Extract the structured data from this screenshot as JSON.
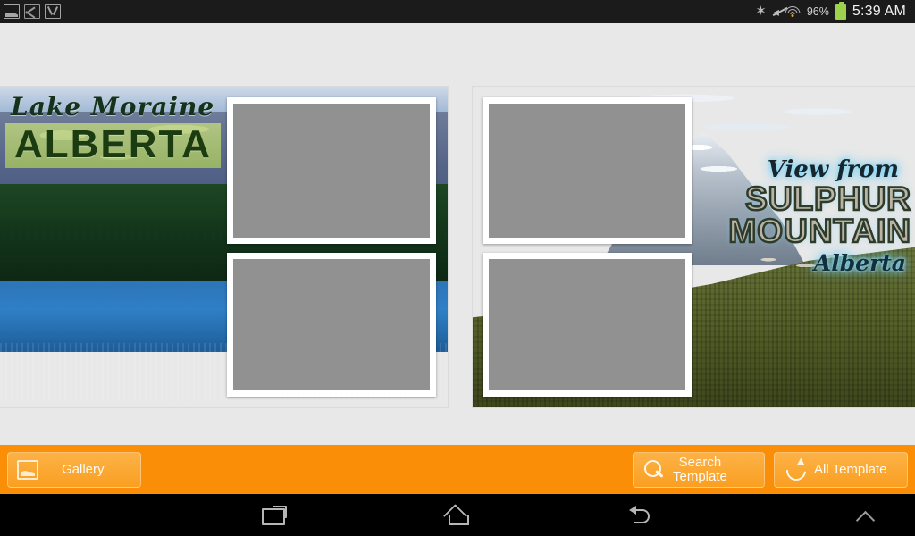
{
  "status_bar": {
    "left_icons": [
      {
        "name": "photo-notification-icon",
        "glyph": "photo"
      },
      {
        "name": "email-notification-icon",
        "glyph": "envelope"
      },
      {
        "name": "gmail-notification-icon",
        "glyph": "gmail"
      }
    ],
    "bluetooth_glyph": "✶",
    "mute_glyph": "◂",
    "battery_percent": "96%",
    "clock": "5:39 AM"
  },
  "templates": [
    {
      "id": "template-left",
      "name": "Lake Moraine Alberta",
      "caption_script": "Lake Moraine",
      "caption_big": "ALBERTA",
      "photo_slots": [
        "slot-l1",
        "slot-l2"
      ]
    },
    {
      "id": "template-right",
      "name": "View from Sulphur Mountain Alberta",
      "caption_script": "View from",
      "caption_stone_line1": "SULPHUR",
      "caption_stone_line2": "MOUNTAIN",
      "caption_alberta": "Alberta",
      "photo_slots": [
        "slot-r1",
        "slot-r2"
      ]
    }
  ],
  "toolbar": {
    "gallery_label": "Gallery",
    "search_template_label": "Search\nTemplate",
    "all_template_label": "All Template"
  },
  "nav_bar": {
    "recents_label": "Recents",
    "home_label": "Home",
    "back_label": "Back",
    "expand_label": "Show navigation"
  },
  "colors": {
    "toolbar_orange": "#fa8e07",
    "button_orange": "#fcb246",
    "page_background": "#e8e8e8",
    "slot_placeholder": "#919191",
    "status_bar": "#1b1b1b",
    "battery_green": "#9ed24c"
  }
}
